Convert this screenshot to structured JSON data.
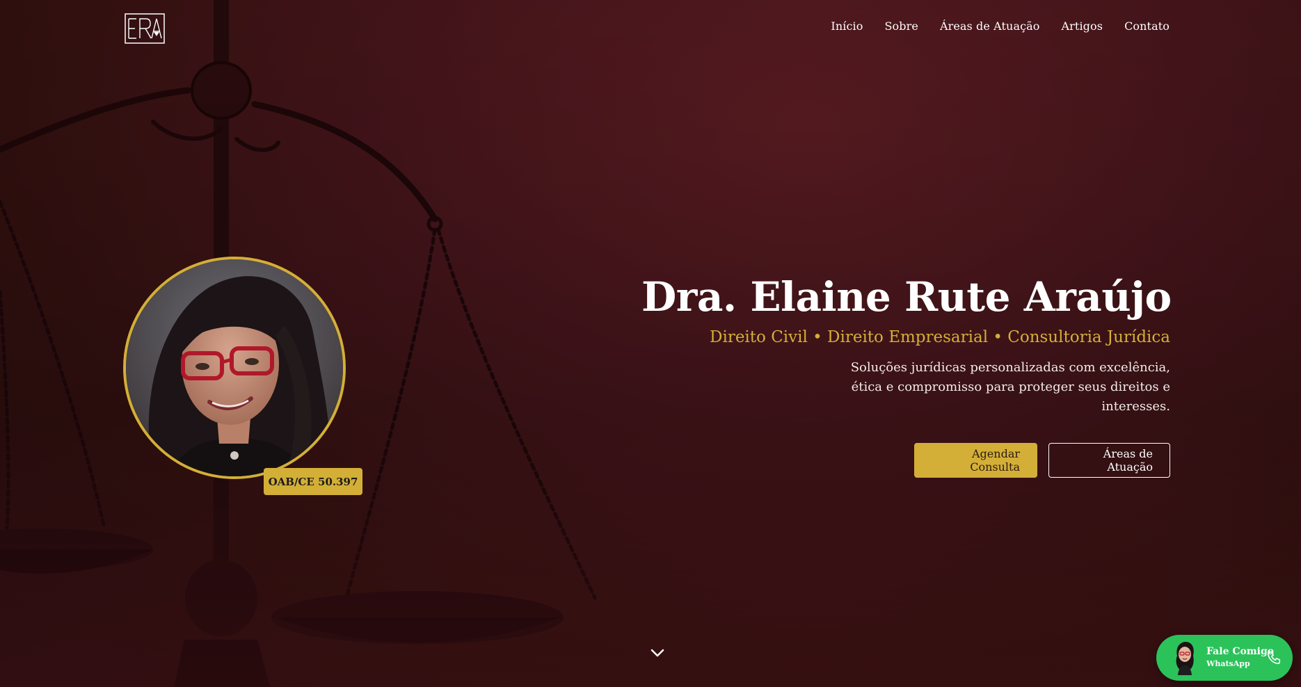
{
  "header": {
    "logo_text": "ERA",
    "nav": [
      {
        "label": "Início"
      },
      {
        "label": "Sobre"
      },
      {
        "label": "Áreas de Atuação"
      },
      {
        "label": "Artigos"
      },
      {
        "label": "Contato"
      }
    ]
  },
  "hero": {
    "title": "Dra. Elaine Rute Araújo",
    "subtitle": "Direito Civil • Direito Empresarial • Consultoria Jurídica",
    "description": "Soluções jurídicas personalizadas com excelência, ética e compromisso para proteger seus direitos e interesses.",
    "primary_button": "Agendar Consulta",
    "secondary_button": "Áreas de Atuação",
    "badge": "OAB/CE 50.397",
    "scroll_icon": "chevron-down-icon"
  },
  "whatsapp": {
    "title": "Fale Comigo",
    "subtitle": "WhatsApp",
    "icon": "phone-icon"
  },
  "colors": {
    "background": "#46151b",
    "accent_gold": "#d4af37",
    "whatsapp_green": "#2bc25a"
  }
}
